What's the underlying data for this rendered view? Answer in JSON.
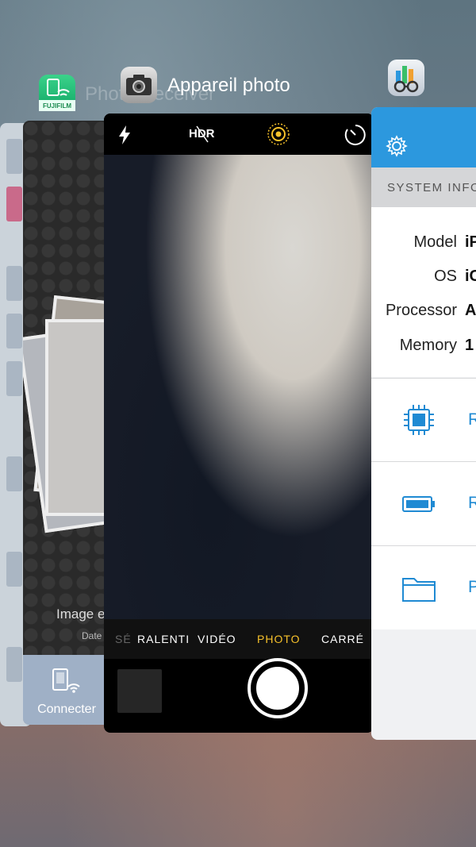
{
  "background_app": {
    "title": "Photo Receiver"
  },
  "fujifilm_app": {
    "icon_text": "FUJIFILM",
    "caption": "Image e",
    "date_label": "Date",
    "connect_label": "Connecter"
  },
  "camera_app": {
    "title": "Appareil photo",
    "hdr_label": "HDR",
    "modes": [
      "SÉ",
      "RALENTI",
      "VIDÉO",
      "PHOTO",
      "CARRÉ"
    ],
    "active_mode": "PHOTO",
    "accent_color": "#f6c12b"
  },
  "system_app": {
    "section_title": "SYSTEM INFO",
    "rows": [
      {
        "label": "Model",
        "value": "iP"
      },
      {
        "label": "OS",
        "value": "iC"
      },
      {
        "label": "Processor",
        "value": "A"
      },
      {
        "label": "Memory",
        "value": "1"
      }
    ],
    "menu": [
      {
        "icon": "cpu-icon",
        "letter": "R"
      },
      {
        "icon": "battery-icon",
        "letter": "R"
      },
      {
        "icon": "folder-icon",
        "letter": "P"
      }
    ],
    "accent_color": "#2c98de"
  }
}
